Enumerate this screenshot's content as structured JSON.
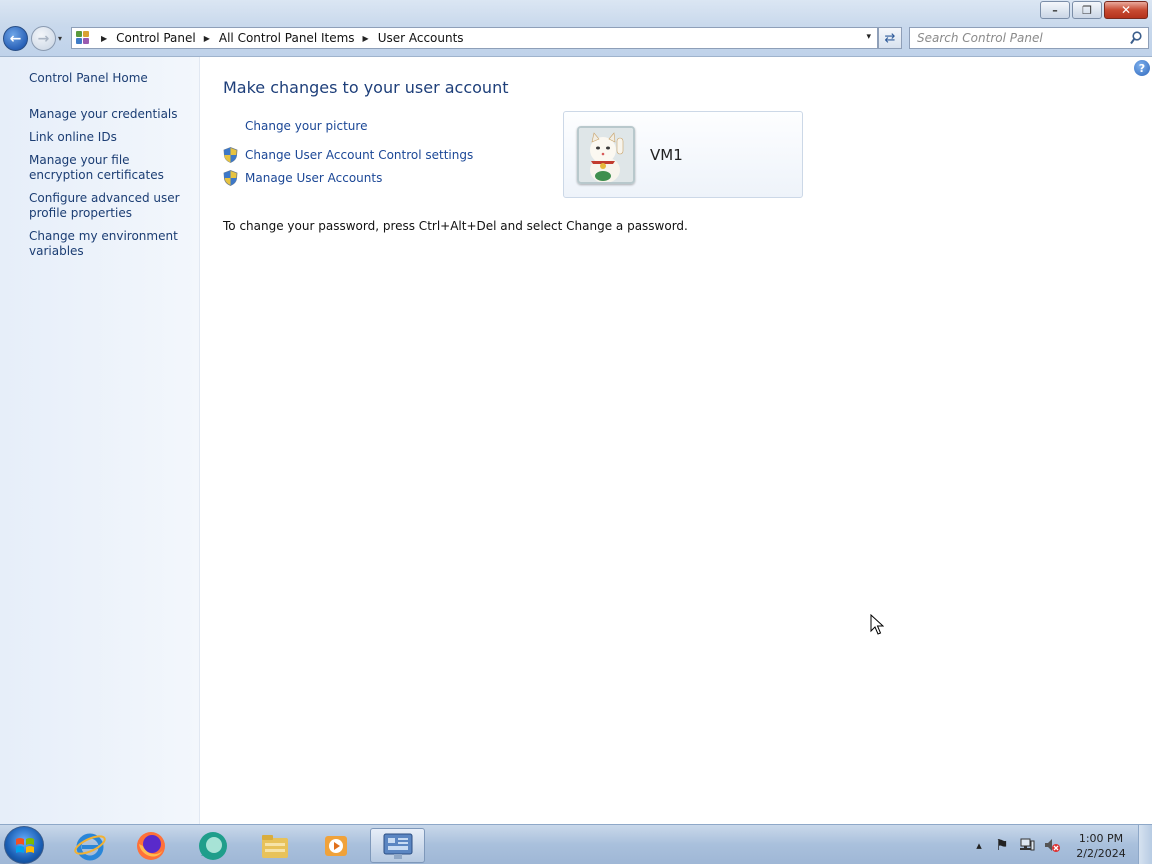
{
  "window": {
    "minimize_glyph": "–",
    "restore_glyph": "❐",
    "close_glyph": "✕"
  },
  "nav": {
    "back_glyph": "←",
    "forward_glyph": "→",
    "dropdown_glyph": "▾"
  },
  "address": {
    "crumbs": [
      "Control Panel",
      "All Control Panel Items",
      "User Accounts"
    ],
    "separator": "▶",
    "dropdown_glyph": "▾"
  },
  "refresh": {
    "glyph": "⇄"
  },
  "search": {
    "placeholder": "Search Control Panel"
  },
  "sidebar": {
    "home": "Control Panel Home",
    "links": [
      "Manage your credentials",
      "Link online IDs",
      "Manage your file encryption certificates",
      "Configure advanced user profile properties",
      "Change my environment variables"
    ]
  },
  "main": {
    "help_glyph": "?",
    "heading": "Make changes to your user account",
    "tasks": [
      "Change your picture",
      "Change User Account Control settings",
      "Manage User Accounts"
    ],
    "password_note": "To change your password, press Ctrl+Alt+Del and select Change a password.",
    "user": {
      "name": "VM1"
    }
  },
  "taskbar": {
    "apps": [
      "internet-explorer-icon",
      "firefox-icon",
      "chat-app-icon",
      "file-explorer-icon",
      "media-player-icon",
      "control-panel-icon"
    ],
    "tray": {
      "up_arrow": "▴",
      "flag_glyph": "⚑"
    },
    "time": "1:00 PM",
    "date": "2/2/2024"
  },
  "colors": {
    "link": "#1b4796",
    "heading": "#1e3f7a",
    "sidebar_link": "#1b3d73"
  }
}
